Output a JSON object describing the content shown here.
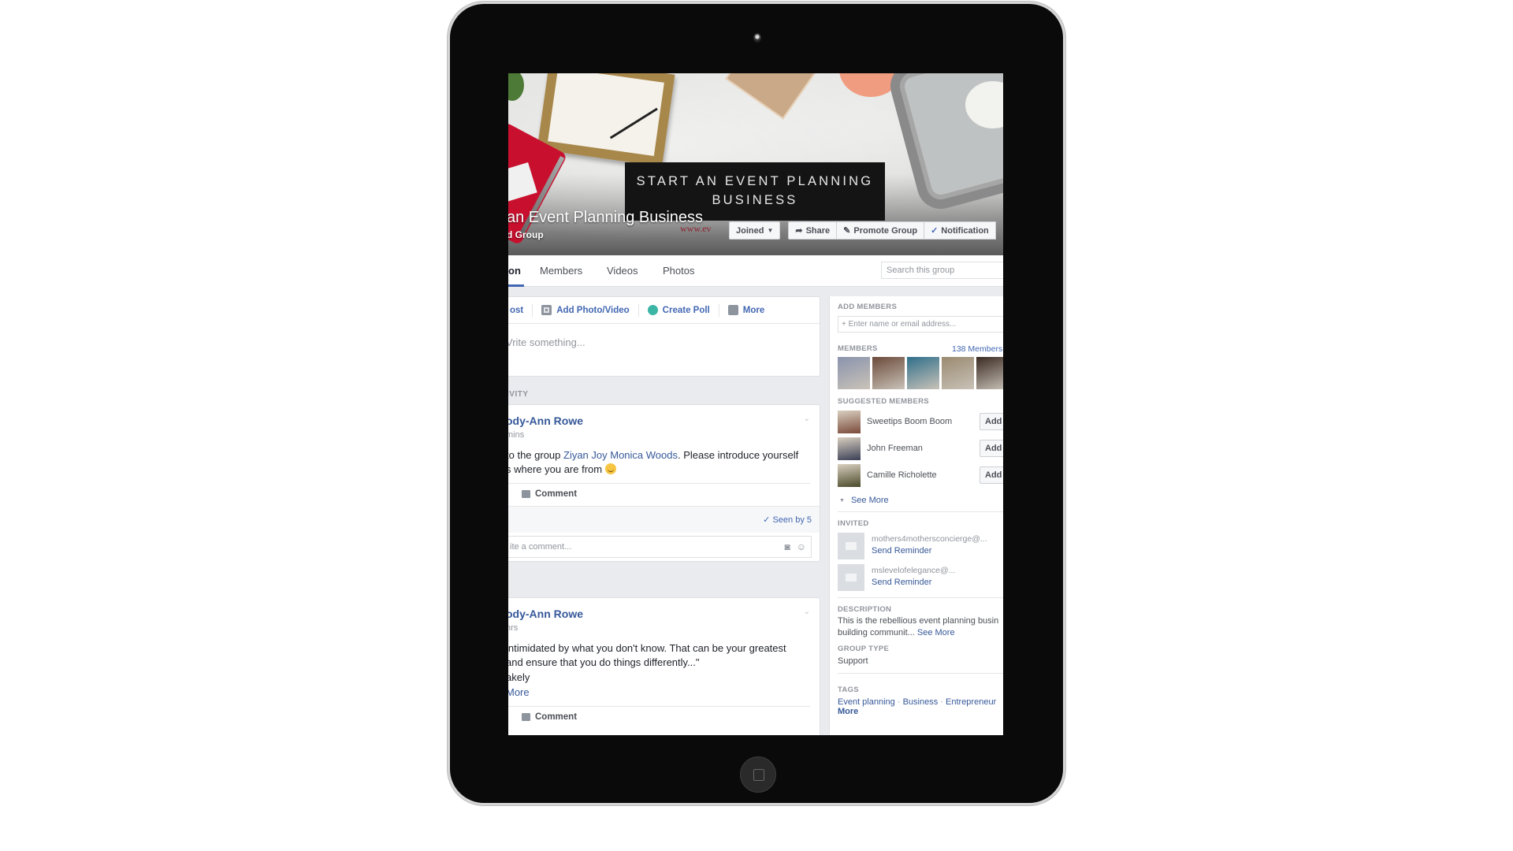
{
  "cover": {
    "banner_line1": "START AN EVENT PLANNING",
    "banner_line2": "BUSINESS",
    "url_fragment": "www.ev",
    "group_title": "an Event Planning Business",
    "group_subtitle": "d Group"
  },
  "actions": {
    "joined": "Joined",
    "share": "Share",
    "promote": "Promote Group",
    "notifications": "Notification"
  },
  "tabs": [
    {
      "label": "on",
      "active": true
    },
    {
      "label": "Members"
    },
    {
      "label": "Videos"
    },
    {
      "label": "Photos"
    }
  ],
  "search": {
    "placeholder": "Search this group"
  },
  "composer": {
    "tabs": [
      "ost",
      "Add Photo/Video",
      "Create Poll",
      "More"
    ],
    "placeholder": "Vrite something..."
  },
  "activity_label": "IVITY",
  "posts": [
    {
      "author": "ody-Ann Rowe",
      "time": "mins",
      "line1_pre": " to the group ",
      "line1_link": "Ziyan Joy Monica Woods",
      "line1_post": ". Please introduce yourself",
      "line2": "s where you are from",
      "comment": "Comment",
      "seen_by": "Seen by 5",
      "comment_placeholder": "ite a comment..."
    },
    {
      "author": "ody-Ann Rowe",
      "time": "hrs",
      "line1": " intimidated by what you don't know. That can be your greatest",
      "line2": "and ensure that you do things differently...\"",
      "line3": "akely",
      "see_more": " More",
      "comment": "Comment"
    }
  ],
  "sidebar": {
    "add_members_label": "ADD MEMBERS",
    "add_members_placeholder": "+ Enter name or email address...",
    "members_label": "MEMBERS",
    "members_count": "138 Members",
    "member_thumb_colors": [
      "#8a94ad",
      "#6b4a3a",
      "#2f6f8a",
      "#9a8a70",
      "#3a2a22"
    ],
    "suggested_label": "SUGGESTED MEMBERS",
    "suggested": [
      {
        "name": "Sweetips Boom Boom",
        "add": "Add",
        "color": "#7a4a3a"
      },
      {
        "name": "John Freeman",
        "add": "Add",
        "color": "#3a3f55"
      },
      {
        "name": "Camille Richolette",
        "add": "Add",
        "color": "#4a4a2a"
      }
    ],
    "see_more": "See More",
    "invited_label": "INVITED",
    "invited": [
      {
        "email": "mothers4mothersconcierge@...",
        "action": "Send Reminder"
      },
      {
        "email": "mslevelofelegance@...",
        "action": "Send Reminder"
      }
    ],
    "description_label": "DESCRIPTION",
    "description_line1": "This is the rebellious event planning busin",
    "description_line2": "building communit... ",
    "description_see_more": "See More",
    "group_type_label": "GROUP TYPE",
    "group_type": "Support",
    "tags_label": "TAGS",
    "tags": [
      "Event planning",
      "Business",
      "Entrepreneur"
    ],
    "tags_more": "More"
  },
  "colors": {
    "accent": "#4267b2",
    "link": "#365899",
    "bezel": "#0a0a0a"
  }
}
